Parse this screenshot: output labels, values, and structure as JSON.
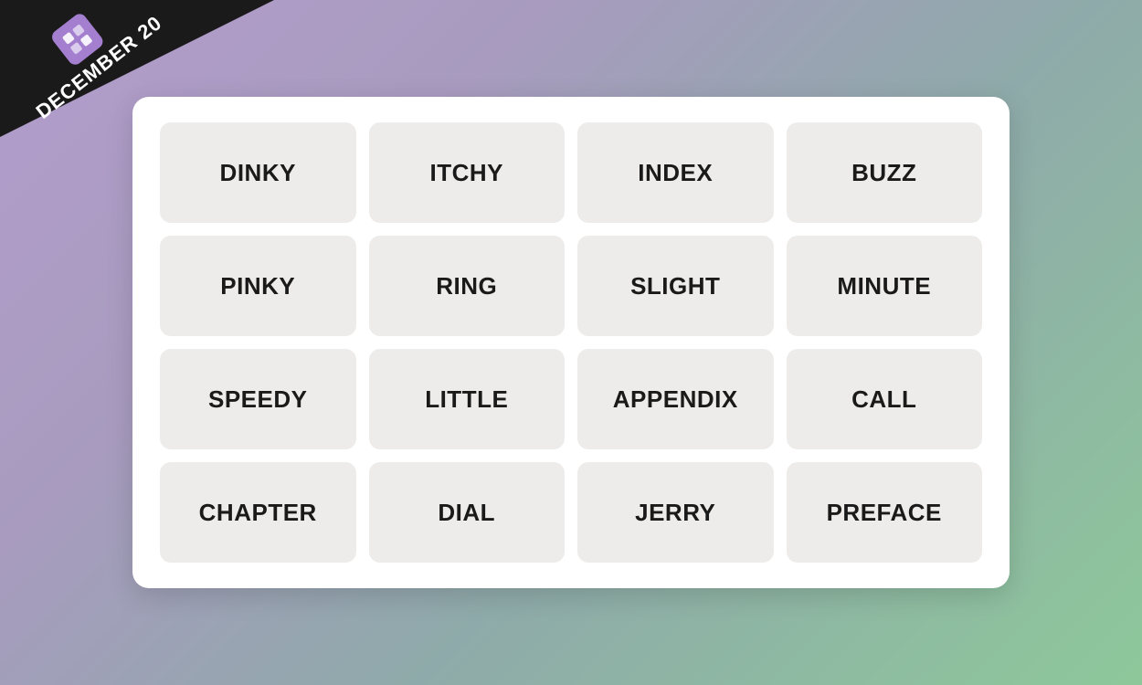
{
  "banner": {
    "date": "DECEMBER 20",
    "icon": "grid-icon"
  },
  "grid": {
    "cells": [
      {
        "label": "DINKY"
      },
      {
        "label": "ITCHY"
      },
      {
        "label": "INDEX"
      },
      {
        "label": "BUZZ"
      },
      {
        "label": "PINKY"
      },
      {
        "label": "RING"
      },
      {
        "label": "SLIGHT"
      },
      {
        "label": "MINUTE"
      },
      {
        "label": "SPEEDY"
      },
      {
        "label": "LITTLE"
      },
      {
        "label": "APPENDIX"
      },
      {
        "label": "CALL"
      },
      {
        "label": "CHAPTER"
      },
      {
        "label": "DIAL"
      },
      {
        "label": "JERRY"
      },
      {
        "label": "PREFACE"
      }
    ]
  }
}
